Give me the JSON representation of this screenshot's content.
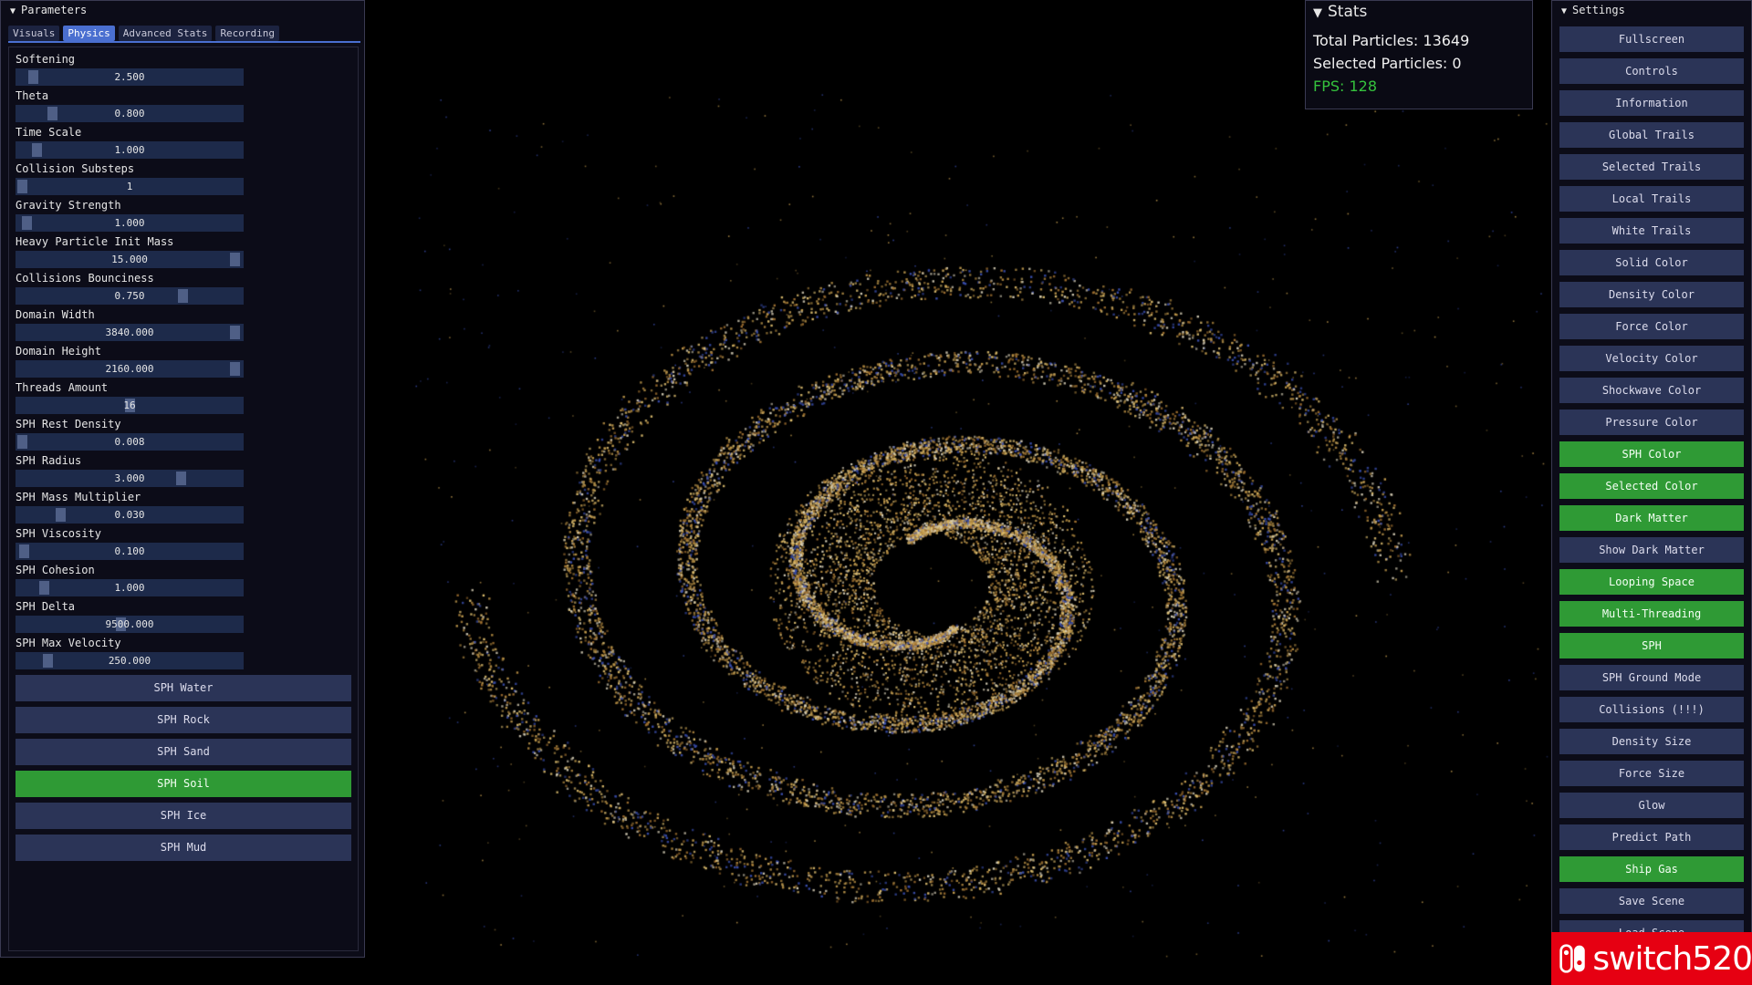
{
  "parameters": {
    "title": "Parameters",
    "tabs": [
      {
        "label": "Visuals",
        "active": false
      },
      {
        "label": "Physics",
        "active": true
      },
      {
        "label": "Advanced Stats",
        "active": false
      },
      {
        "label": "Recording",
        "active": false
      }
    ],
    "sliders": [
      {
        "label": "Softening",
        "value": "2.500",
        "level": 0.05
      },
      {
        "label": "Theta",
        "value": "0.800",
        "level": 0.14
      },
      {
        "label": "Time Scale",
        "value": "1.000",
        "level": 0.07
      },
      {
        "label": "Collision Substeps",
        "value": "1",
        "level": 0.0
      },
      {
        "label": "Gravity Strength",
        "value": "1.000",
        "level": 0.02
      },
      {
        "label": "Heavy Particle Init Mass",
        "value": "15.000",
        "level": 0.99
      },
      {
        "label": "Collisions Bounciness",
        "value": "0.750",
        "level": 0.75
      },
      {
        "label": "Domain Width",
        "value": "3840.000",
        "level": 0.99
      },
      {
        "label": "Domain Height",
        "value": "2160.000",
        "level": 0.99
      },
      {
        "label": "Threads Amount",
        "value": "16",
        "level": 0.5
      },
      {
        "label": "SPH Rest Density",
        "value": "0.008",
        "level": 0.0
      },
      {
        "label": "SPH Radius",
        "value": "3.000",
        "level": 0.74
      },
      {
        "label": "SPH Mass Multiplier",
        "value": "0.030",
        "level": 0.18
      },
      {
        "label": "SPH Viscosity",
        "value": "0.100",
        "level": 0.01
      },
      {
        "label": "SPH Cohesion",
        "value": "1.000",
        "level": 0.1
      },
      {
        "label": "SPH Delta",
        "value": "9500.000",
        "level": 0.46
      },
      {
        "label": "SPH Max Velocity",
        "value": "250.000",
        "level": 0.12
      }
    ],
    "presets": [
      {
        "label": "SPH Water",
        "on": false
      },
      {
        "label": "SPH Rock",
        "on": false
      },
      {
        "label": "SPH Sand",
        "on": false
      },
      {
        "label": "SPH Soil",
        "on": true
      },
      {
        "label": "SPH Ice",
        "on": false
      },
      {
        "label": "SPH Mud",
        "on": false
      }
    ]
  },
  "stats": {
    "title": "Stats",
    "total_particles": "Total Particles: 13649",
    "selected_particles": "Selected Particles: 0",
    "fps": "FPS: 128",
    "fps_color": "#35c23d"
  },
  "settings": {
    "title": "Settings",
    "buttons": [
      {
        "label": "Fullscreen",
        "on": false
      },
      {
        "label": "Controls",
        "on": false
      },
      {
        "label": "Information",
        "on": false
      },
      {
        "label": "Global Trails",
        "on": false
      },
      {
        "label": "Selected Trails",
        "on": false
      },
      {
        "label": "Local Trails",
        "on": false
      },
      {
        "label": "White Trails",
        "on": false
      },
      {
        "label": "Solid Color",
        "on": false
      },
      {
        "label": "Density Color",
        "on": false
      },
      {
        "label": "Force Color",
        "on": false
      },
      {
        "label": "Velocity Color",
        "on": false
      },
      {
        "label": "Shockwave Color",
        "on": false
      },
      {
        "label": "Pressure Color",
        "on": false
      },
      {
        "label": "SPH Color",
        "on": true
      },
      {
        "label": "Selected Color",
        "on": true
      },
      {
        "label": "Dark Matter",
        "on": true
      },
      {
        "label": "Show Dark Matter",
        "on": false
      },
      {
        "label": "Looping Space",
        "on": true
      },
      {
        "label": "Multi-Threading",
        "on": true
      },
      {
        "label": "SPH",
        "on": true
      },
      {
        "label": "SPH Ground Mode",
        "on": false
      },
      {
        "label": "Collisions (!!!)",
        "on": false
      },
      {
        "label": "Density Size",
        "on": false
      },
      {
        "label": "Force Size",
        "on": false
      },
      {
        "label": "Glow",
        "on": false
      },
      {
        "label": "Predict Path",
        "on": false
      },
      {
        "label": "Ship Gas",
        "on": true
      },
      {
        "label": "Save Scene",
        "on": false
      },
      {
        "label": "Load Scene",
        "on": false
      }
    ]
  },
  "watermark": {
    "text": "switch520",
    "color": "#e60012"
  },
  "colors": {
    "accent_green": "#2f9a35",
    "button_default": "#2b3457",
    "tab_active": "#4a6fd0",
    "particle_gold": "#c8a050",
    "particle_blue": "#3a4fb0"
  }
}
